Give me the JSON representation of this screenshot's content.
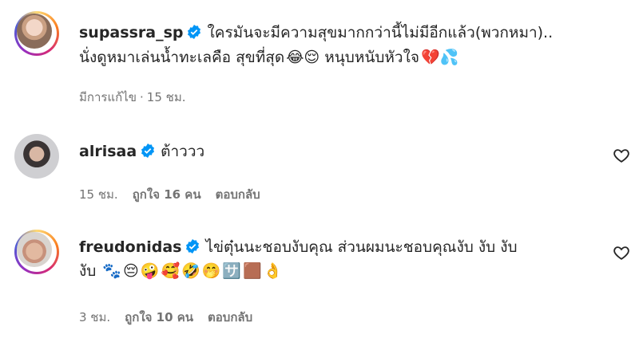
{
  "post": {
    "username": "supassra_sp",
    "caption_line1": "ใครมันจะมีความสุขมากกว่านี้ไม่มีอีกแล้ว(พวกหมา)..",
    "caption_line2_text": "นั่งดูหมาเล่นน้ำทะเลคือ สุขที่สุด",
    "caption_line2_emojis": "😂😌",
    "caption_line2_tail": " หนุบหนับหัวใจ",
    "caption_line2_tail_emojis": "💔💦",
    "edited_label": "มีการแก้ไข",
    "time": "15 ชม."
  },
  "comments": [
    {
      "username": "alrisaa",
      "text": "ต้าววว",
      "time": "15 ชม.",
      "likes": "ถูกใจ 16 คน",
      "reply": "ตอบกลับ"
    },
    {
      "username": "freudonidas",
      "text_line1": "ไข่ตุ๋นนะชอบงับคุณ ส่วนผมนะชอบคุณงับ งับ งับ",
      "text_line2": "งับ",
      "emojis": "🐾😔🤪🥰🤣🤭🈂️🟫👌",
      "time": "3 ชม.",
      "likes": "ถูกใจ 10 คน",
      "reply": "ตอบกลับ"
    }
  ],
  "colors": {
    "verified": "#0095f6",
    "meta": "#737373",
    "text": "#262626"
  }
}
